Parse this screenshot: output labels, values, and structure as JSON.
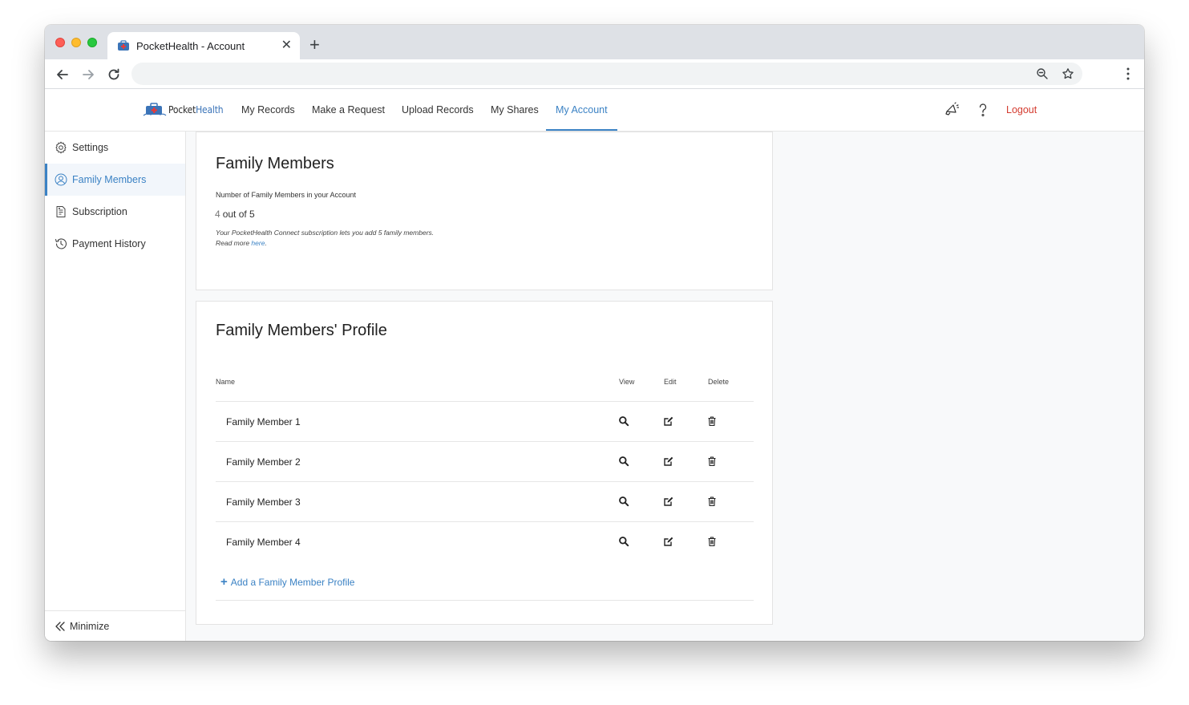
{
  "browser": {
    "tab_title": "PocketHealth - Account",
    "address": ""
  },
  "app": {
    "logo_prefix": "Pocket",
    "logo_suffix": "Health",
    "nav": [
      {
        "label": "My Records"
      },
      {
        "label": "Make a Request"
      },
      {
        "label": "Upload Records"
      },
      {
        "label": "My Shares"
      },
      {
        "label": "My Account",
        "active": true
      }
    ],
    "logout_label": "Logout",
    "icons": [
      "megaphone-icon",
      "help-icon"
    ]
  },
  "sidebar": {
    "items": [
      {
        "label": "Settings",
        "icon": "gear-icon"
      },
      {
        "label": "Family Members",
        "icon": "user-circle-icon",
        "active": true
      },
      {
        "label": "Subscription",
        "icon": "document-icon"
      },
      {
        "label": "Payment History",
        "icon": "history-icon"
      }
    ],
    "minimize_label": "Minimize"
  },
  "family_card": {
    "title": "Family Members",
    "count_label": "Number of Family Members in your Account",
    "count_used": "4",
    "count_rest": "out of 5",
    "note_line1": "Your PocketHealth Connect subscription lets you add 5 family members.",
    "note_line2_prefix": "Read more ",
    "note_link": "here",
    "note_line2_suffix": "."
  },
  "profile_card": {
    "title": "Family Members' Profile",
    "headers": {
      "name": "Name",
      "view": "View",
      "edit": "Edit",
      "delete": "Delete"
    },
    "rows": [
      {
        "name": "Family Member 1"
      },
      {
        "name": "Family Member 2"
      },
      {
        "name": "Family Member 3"
      },
      {
        "name": "Family Member 4"
      }
    ],
    "add_label": "Add a Family Member Profile"
  },
  "colors": {
    "accent": "#3b82c4",
    "logout": "#d43b2f"
  }
}
